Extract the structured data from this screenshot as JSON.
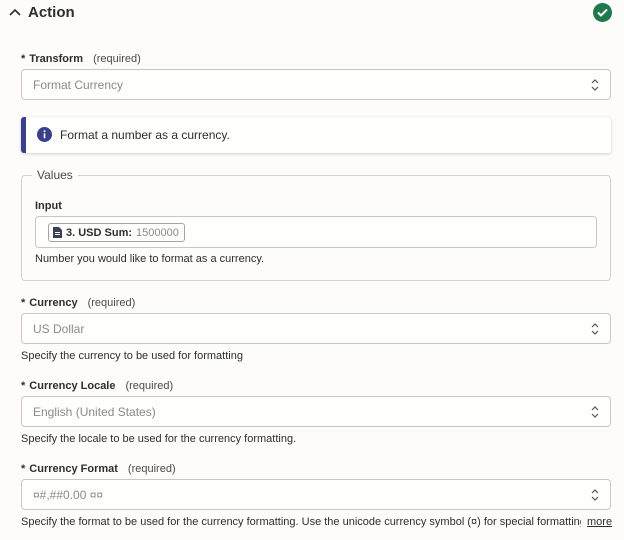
{
  "header": {
    "title": "Action",
    "status_icon": "check-circle-icon",
    "status_color": "#1d7a4c"
  },
  "transform": {
    "star": "*",
    "label": "Transform",
    "required": "(required)",
    "value": "Format Currency"
  },
  "info": {
    "text": "Format a number as a currency.",
    "accent": "#3b3d8f"
  },
  "values": {
    "legend": "Values",
    "input_label": "Input",
    "pill_step": "3. USD Sum:",
    "pill_value": "1500000",
    "help": "Number you would like to format as a currency."
  },
  "currency": {
    "star": "*",
    "label": "Currency",
    "required": "(required)",
    "value": "US Dollar",
    "help": "Specify the currency to be used for formatting"
  },
  "locale": {
    "star": "*",
    "label": "Currency Locale",
    "required": "(required)",
    "value": "English (United States)",
    "help": "Specify the locale to be used for the currency formatting."
  },
  "format": {
    "star": "*",
    "label": "Currency Format",
    "required": "(required)",
    "value": "¤#,##0.00 ¤¤",
    "help": "Specify the format to be used for the currency formatting. Use the unicode currency symbol (¤) for special formatting...",
    "more": "more"
  }
}
